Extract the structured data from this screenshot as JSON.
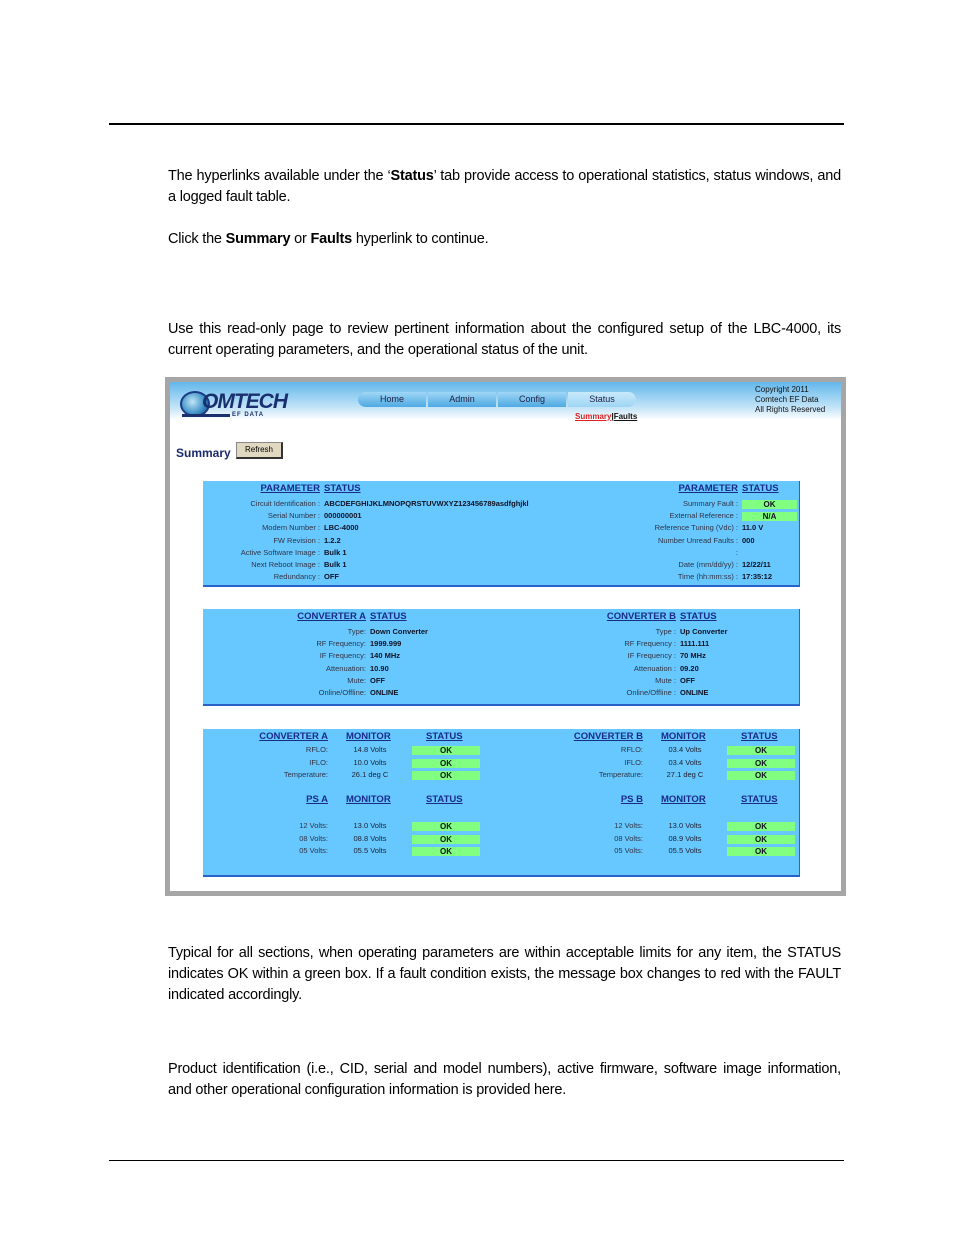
{
  "document": {
    "intro_paragraph": {
      "pre": "The hyperlinks available under the ‘",
      "bold": "Status",
      "post": "’ tab provide access to operational statistics, status windows, and a logged fault table."
    },
    "click_paragraph": {
      "pre": "Click the ",
      "bold1": "Summary",
      "mid": " or ",
      "bold2": "Faults",
      "post": " hyperlink to continue."
    },
    "summary_paragraph": "Use this read-only page to review pertinent information about the configured setup of the LBC-4000, its current operating parameters, and the operational status of the unit.",
    "typical_paragraph": "Typical for all sections, when operating parameters are within acceptable limits for any item, the STATUS indicates OK within a green box. If a fault condition exists, the message box changes to red with the FAULT indicated accordingly.",
    "product_paragraph": "Product identification (i.e., CID, serial and model numbers), active firmware, software image information, and other operational configuration information is provided here."
  },
  "screen": {
    "logo": {
      "word": "OMTECH",
      "sub": "EF DATA"
    },
    "tabs": [
      "Home",
      "Admin",
      "Config",
      "Status"
    ],
    "active_tab": "Status",
    "sublinks": {
      "summary": "Summary",
      "separator": "|",
      "faults": "Faults"
    },
    "copyright": [
      "Copyright 2011",
      "Comtech EF Data",
      "All Rights Reserved"
    ],
    "page_title": "Summary",
    "refresh_label": "Refresh",
    "colors": {
      "panel": "#66c8ff",
      "ok_box": "#80ff80",
      "active_link": "#e02020"
    },
    "parameters": {
      "left_header": [
        "PARAMETER",
        "STATUS"
      ],
      "right_header": [
        "PARAMETER",
        "STATUS"
      ],
      "left": [
        {
          "label": "Circuit Identification :",
          "value": "ABCDEFGHIJKLMNOPQRSTUVWXYZ123456789asdfghjkl"
        },
        {
          "label": "Serial Number :",
          "value": "000000001"
        },
        {
          "label": "Modem Number :",
          "value": "LBC-4000"
        },
        {
          "label": "FW Revision :",
          "value": "1.2.2"
        },
        {
          "label": "Active Software Image :",
          "value": "Bulk 1"
        },
        {
          "label": "Next Reboot Image :",
          "value": "Bulk 1"
        },
        {
          "label": "Redundancy :",
          "value": "OFF"
        }
      ],
      "right": [
        {
          "label": "Summary Fault :",
          "value": "OK",
          "box": true
        },
        {
          "label": "External Reference :",
          "value": "N/A",
          "box": true
        },
        {
          "label": "Reference Tuning (Vdc) :",
          "value": "11.0 V"
        },
        {
          "label": "Number Unread Faults :",
          "value": "000"
        },
        {
          "label": ":",
          "value": ""
        },
        {
          "label": "Date (mm/dd/yy) :",
          "value": "12/22/11"
        },
        {
          "label": "Time (hh:mm:ss) :",
          "value": "17:35:12"
        }
      ]
    },
    "converters": {
      "a_header": [
        "CONVERTER A",
        "STATUS"
      ],
      "b_header": [
        "CONVERTER B",
        "STATUS"
      ],
      "a": [
        {
          "label": "Type:",
          "value": "Down Converter"
        },
        {
          "label": "RF Frequency:",
          "value": "1999.999"
        },
        {
          "label": "IF Frequency:",
          "value": "140 MHz"
        },
        {
          "label": "Attenuation:",
          "value": "10.90"
        },
        {
          "label": "Mute:",
          "value": "OFF"
        },
        {
          "label": "Online/Offline:",
          "value": "ONLINE"
        }
      ],
      "b": [
        {
          "label": "Type :",
          "value": "Up Converter"
        },
        {
          "label": "RF Frequency :",
          "value": "1111.111"
        },
        {
          "label": "IF Frequency :",
          "value": "70 MHz"
        },
        {
          "label": "Attenuation :",
          "value": "09.20"
        },
        {
          "label": "Mute :",
          "value": "OFF"
        },
        {
          "label": "Online/Offline :",
          "value": "ONLINE"
        }
      ]
    },
    "monitor": {
      "conv_a_header": [
        "CONVERTER A",
        "MONITOR",
        "STATUS"
      ],
      "conv_b_header": [
        "CONVERTER B",
        "MONITOR",
        "STATUS"
      ],
      "conv_a": [
        {
          "label": "RFLO:",
          "monitor": "14.8 Volts",
          "status": "OK"
        },
        {
          "label": "IFLO:",
          "monitor": "10.0 Volts",
          "status": "OK"
        },
        {
          "label": "Temperature:",
          "monitor": "26.1 deg C",
          "status": "OK"
        }
      ],
      "conv_b": [
        {
          "label": "RFLO:",
          "monitor": "03.4 Volts",
          "status": "OK"
        },
        {
          "label": "IFLO:",
          "monitor": "03.4 Volts",
          "status": "OK"
        },
        {
          "label": "Temperature:",
          "monitor": "27.1 deg C",
          "status": "OK"
        }
      ],
      "ps_a_header": [
        "PS A",
        "MONITOR",
        "STATUS"
      ],
      "ps_b_header": [
        "PS B",
        "MONITOR",
        "STATUS"
      ],
      "ps_a": [
        {
          "label": "12 Volts:",
          "monitor": "13.0 Volts",
          "status": "OK"
        },
        {
          "label": "08 Volts:",
          "monitor": "08.8 Volts",
          "status": "OK"
        },
        {
          "label": "05 Volts:",
          "monitor": "05.5 Volts",
          "status": "OK"
        }
      ],
      "ps_b": [
        {
          "label": "12 Volts:",
          "monitor": "13.0 Volts",
          "status": "OK"
        },
        {
          "label": "08 Volts:",
          "monitor": "08.9 Volts",
          "status": "OK"
        },
        {
          "label": "05 Volts:",
          "monitor": "05.5 Volts",
          "status": "OK"
        }
      ]
    }
  }
}
